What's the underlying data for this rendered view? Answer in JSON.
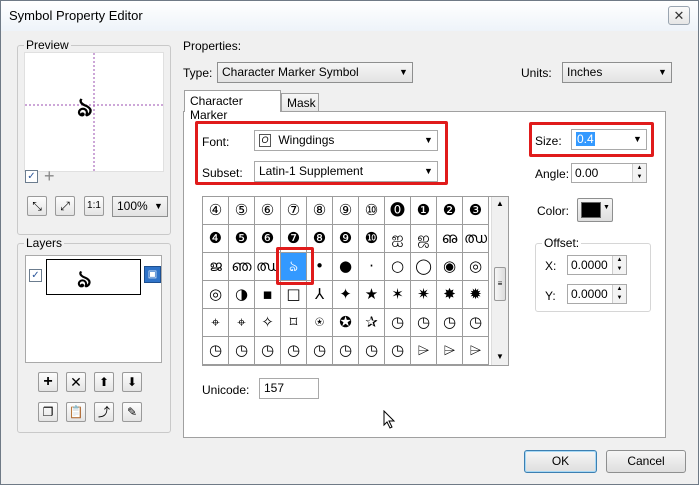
{
  "window": {
    "title": "Symbol Property Editor",
    "close_glyph": "✕"
  },
  "preview": {
    "label": "Preview",
    "zoom": "100%",
    "preview_glyph": "ঌ"
  },
  "layers": {
    "label": "Layers",
    "layer_glyph": "ঌ"
  },
  "properties": {
    "label": "Properties:",
    "type_label": "Type:",
    "type_value": "Character Marker Symbol",
    "units_label": "Units:",
    "units_value": "Inches"
  },
  "tabs": [
    {
      "label": "Character Marker"
    },
    {
      "label": "Mask"
    }
  ],
  "marker": {
    "font_label": "Font:",
    "font_value": "Wingdings",
    "subset_label": "Subset:",
    "subset_value": "Latin-1 Supplement",
    "size_label": "Size:",
    "size_value": "0.4",
    "angle_label": "Angle:",
    "angle_value": "0.00",
    "color_label": "Color:",
    "color_hex": "#000000",
    "offset_label": "Offset:",
    "x_label": "X:",
    "x_value": "0.0000",
    "y_label": "Y:",
    "y_value": "0.0000",
    "unicode_label": "Unicode:",
    "unicode_value": "157"
  },
  "charmap": {
    "rows": [
      [
        "④",
        "⑤",
        "⑥",
        "⑦",
        "⑧",
        "⑨",
        "⑩",
        "⓿",
        "❶",
        "❷",
        "❸"
      ],
      [
        "❹",
        "❺",
        "❻",
        "❼",
        "❽",
        "❾",
        "❿",
        "ஐ",
        "ஜ",
        "ഌ",
        "ഝ"
      ],
      [
        "ജ",
        "ഞ",
        "ഝ",
        "ঌ",
        "•",
        "●",
        "·",
        "○",
        "◯",
        "◉",
        "◎"
      ],
      [
        "◎",
        "◑",
        "▪",
        "□",
        "⅄",
        "✦",
        "★",
        "✶",
        "✷",
        "✸",
        "✹"
      ],
      [
        "⌖",
        "⌖",
        "✧",
        "⌑",
        "⍟",
        "✪",
        "✰",
        "◷",
        "◷",
        "◷",
        "◷"
      ],
      [
        "◷",
        "◷",
        "◷",
        "◷",
        "◷",
        "◷",
        "◷",
        "◷",
        "⌲",
        "⌲",
        "⌲"
      ]
    ]
  },
  "buttons": {
    "ok": "OK",
    "cancel": "Cancel"
  }
}
